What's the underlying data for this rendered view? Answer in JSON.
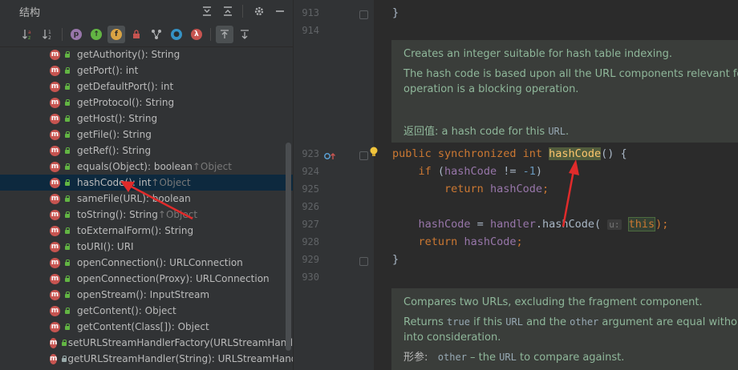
{
  "structure": {
    "title": "结构",
    "header_icons": [
      "expand-all-icon",
      "collapse-all-icon",
      "gear-icon",
      "minimize-icon"
    ],
    "toolbar_icons": [
      "sort-alpha-icon",
      "sort-visibility-icon",
      "show-properties-icon",
      "show-inherited-icon",
      "show-fields-icon",
      "show-non-public-icon",
      "show-anonymous-icon",
      "show-lambdas-icon",
      "autoscroll-to-source-icon",
      "autoscroll-from-source-icon"
    ],
    "items": [
      {
        "name": "getAuthority(): String",
        "override": ""
      },
      {
        "name": "getPort(): int",
        "override": ""
      },
      {
        "name": "getDefaultPort(): int",
        "override": ""
      },
      {
        "name": "getProtocol(): String",
        "override": ""
      },
      {
        "name": "getHost(): String",
        "override": ""
      },
      {
        "name": "getFile(): String",
        "override": ""
      },
      {
        "name": "getRef(): String",
        "override": ""
      },
      {
        "name": "equals(Object): boolean ",
        "override": "↑Object"
      },
      {
        "name": "hashCode(): int ",
        "override": "↑Object"
      },
      {
        "name": "sameFile(URL): boolean",
        "override": ""
      },
      {
        "name": "toString(): String ",
        "override": "↑Object"
      },
      {
        "name": "toExternalForm(): String",
        "override": ""
      },
      {
        "name": "toURI(): URI",
        "override": ""
      },
      {
        "name": "openConnection(): URLConnection",
        "override": ""
      },
      {
        "name": "openConnection(Proxy): URLConnection",
        "override": ""
      },
      {
        "name": "openStream(): InputStream",
        "override": ""
      },
      {
        "name": "getContent(): Object",
        "override": ""
      },
      {
        "name": "getContent(Class[]): Object",
        "override": ""
      },
      {
        "name": "setURLStreamHandlerFactory(URLStreamHand",
        "override": ""
      },
      {
        "name": "getURLStreamHandler(String): URLStreamHand",
        "override": ""
      }
    ],
    "selected_index": 8
  },
  "editor": {
    "line_numbers": [
      "913",
      "914",
      "923",
      "924",
      "925",
      "926",
      "927",
      "928",
      "929",
      "930"
    ],
    "doc1": {
      "line1": "Creates an integer suitable for hash table indexing.",
      "line2": "The hash code is based upon all the URL components relevant for U",
      "line3": "operation is a blocking operation.",
      "return_label": "返回值: ",
      "return_text": "a hash code for this ",
      "return_code": "URL",
      "return_end": "."
    },
    "code": {
      "l913": "}",
      "kw_public": "public",
      "kw_sync": "synchronized",
      "kw_int": "int",
      "method": "hashCode",
      "sig_end": "() {",
      "kw_if": "if",
      "if_open": " (",
      "field": "hashCode",
      "cmp": " != ",
      "neg_one": "-1",
      "close": ")",
      "kw_return": "return",
      "semicolon": ";",
      "assign": " = ",
      "handler": "handler",
      "dot_call": ".hashCode( ",
      "param_hint": "u:",
      "kw_this": "this",
      "call_end": ");",
      "close_brace": "}"
    },
    "doc2": {
      "line1": "Compares two URLs, excluding the fragment component.",
      "line2a": "Returns ",
      "line2b": "true",
      "line2c": " if this ",
      "line2d": "URL",
      "line2e": " and the ",
      "line2f": "other",
      "line2g": " argument are equal without t",
      "line3": "into consideration.",
      "param_label": "形参:",
      "param_code": "other",
      "param_text": " – the ",
      "param_code2": "URL",
      "param_end": " to compare against."
    }
  }
}
